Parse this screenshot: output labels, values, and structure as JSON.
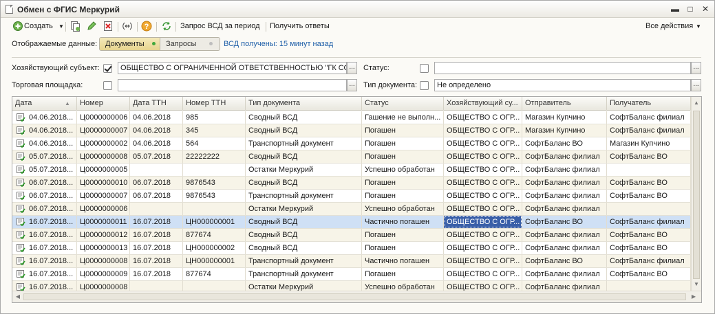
{
  "window": {
    "title": "Обмен с ФГИС Меркурий",
    "controls": [
      "minimize",
      "maximize",
      "close"
    ]
  },
  "toolbar": {
    "create_label": "Создать",
    "request_vsd_label": "Запрос ВСД за период",
    "get_answers_label": "Получить ответы",
    "all_actions_label": "Все действия"
  },
  "filter": {
    "display_label": "Отображаемые данные:",
    "docs_label": "Документы",
    "requests_label": "Запросы",
    "vsd_status": "ВСД получены: 15 минут назад"
  },
  "form": {
    "entity_label": "Хозяйствующий субъект:",
    "entity_checked": true,
    "entity_value": "ОБЩЕСТВО С ОГРАНИЧЕННОЙ ОТВЕТСТВЕННОСТЬЮ \"ГК СО\"",
    "status_label": "Статус:",
    "status_checked": false,
    "status_value": "",
    "platform_label": "Торговая площадка:",
    "platform_checked": false,
    "platform_value": "",
    "doctype_label": "Тип документа:",
    "doctype_checked": false,
    "doctype_value": "Не определено"
  },
  "grid": {
    "columns": [
      "Дата",
      "Номер",
      "Дата ТТН",
      "Номер ТТН",
      "Тип документа",
      "Статус",
      "Хозяйствующий су...",
      "Отправитель",
      "Получатель"
    ],
    "rows": [
      [
        "04.06.2018...",
        "Ц0000000006",
        "04.06.2018",
        "985",
        "Сводный ВСД",
        "Гашение не выполн...",
        "ОБЩЕСТВО С ОГР...",
        "Магазин Купчино",
        "СофтБаланс филиал"
      ],
      [
        "04.06.2018...",
        "Ц0000000007",
        "04.06.2018",
        "345",
        "Сводный ВСД",
        "Погашен",
        "ОБЩЕСТВО С ОГР...",
        "Магазин Купчино",
        "СофтБаланс филиал"
      ],
      [
        "04.06.2018...",
        "Ц0000000002",
        "04.06.2018",
        "564",
        "Транспортный документ",
        "Погашен",
        "ОБЩЕСТВО С ОГР...",
        "СофтБаланс ВО",
        "Магазин Купчино"
      ],
      [
        "05.07.2018...",
        "Ц0000000008",
        "05.07.2018",
        "22222222",
        "Сводный ВСД",
        "Погашен",
        "ОБЩЕСТВО С ОГР...",
        "СофтБаланс филиал",
        "СофтБаланс ВО"
      ],
      [
        "05.07.2018...",
        "Ц0000000005",
        "",
        "",
        "Остатки Меркурий",
        "Успешно обработан",
        "ОБЩЕСТВО С ОГР...",
        "СофтБаланс филиал",
        ""
      ],
      [
        "06.07.2018...",
        "Ц0000000010",
        "06.07.2018",
        "9876543",
        "Сводный ВСД",
        "Погашен",
        "ОБЩЕСТВО С ОГР...",
        "СофтБаланс филиал",
        "СофтБаланс ВО"
      ],
      [
        "06.07.2018...",
        "Ц0000000007",
        "06.07.2018",
        "9876543",
        "Транспортный документ",
        "Погашен",
        "ОБЩЕСТВО С ОГР...",
        "СофтБаланс филиал",
        "СофтБаланс ВО"
      ],
      [
        "06.07.2018...",
        "Ц0000000006",
        "",
        "",
        "Остатки Меркурий",
        "Успешно обработан",
        "ОБЩЕСТВО С ОГР...",
        "СофтБаланс филиал",
        ""
      ],
      [
        "16.07.2018...",
        "Ц0000000011",
        "16.07.2018",
        "ЦН000000001",
        "Сводный ВСД",
        "Частично погашен",
        "ОБЩЕСТВО С ОГР...",
        "СофтБаланс ВО",
        "СофтБаланс филиал"
      ],
      [
        "16.07.2018...",
        "Ц0000000012",
        "16.07.2018",
        "877674",
        "Сводный ВСД",
        "Погашен",
        "ОБЩЕСТВО С ОГР...",
        "СофтБаланс филиал",
        "СофтБаланс ВО"
      ],
      [
        "16.07.2018...",
        "Ц0000000013",
        "16.07.2018",
        "ЦН000000002",
        "Сводный ВСД",
        "Погашен",
        "ОБЩЕСТВО С ОГР...",
        "СофтБаланс филиал",
        "СофтБаланс ВО"
      ],
      [
        "16.07.2018...",
        "Ц0000000008",
        "16.07.2018",
        "ЦН000000001",
        "Транспортный документ",
        "Частично погашен",
        "ОБЩЕСТВО С ОГР...",
        "СофтБаланс ВО",
        "СофтБаланс филиал"
      ],
      [
        "16.07.2018...",
        "Ц0000000009",
        "16.07.2018",
        "877674",
        "Транспортный документ",
        "Погашен",
        "ОБЩЕСТВО С ОГР...",
        "СофтБаланс филиал",
        "СофтБаланс ВО"
      ],
      [
        "16.07.2018...",
        "Ц0000000008",
        "",
        "",
        "Остатки Меркурий",
        "Успешно обработан",
        "ОБЩЕСТВО С ОГР...",
        "СофтБаланс филиал",
        ""
      ]
    ],
    "selected_row": 8,
    "sort_column": "Дата"
  },
  "colors": {
    "accent_link": "#1d5ea8",
    "selected_row": "#cfe0f5",
    "focused_cell": "#3a5fa8",
    "alt_row": "#f7f4e8"
  }
}
